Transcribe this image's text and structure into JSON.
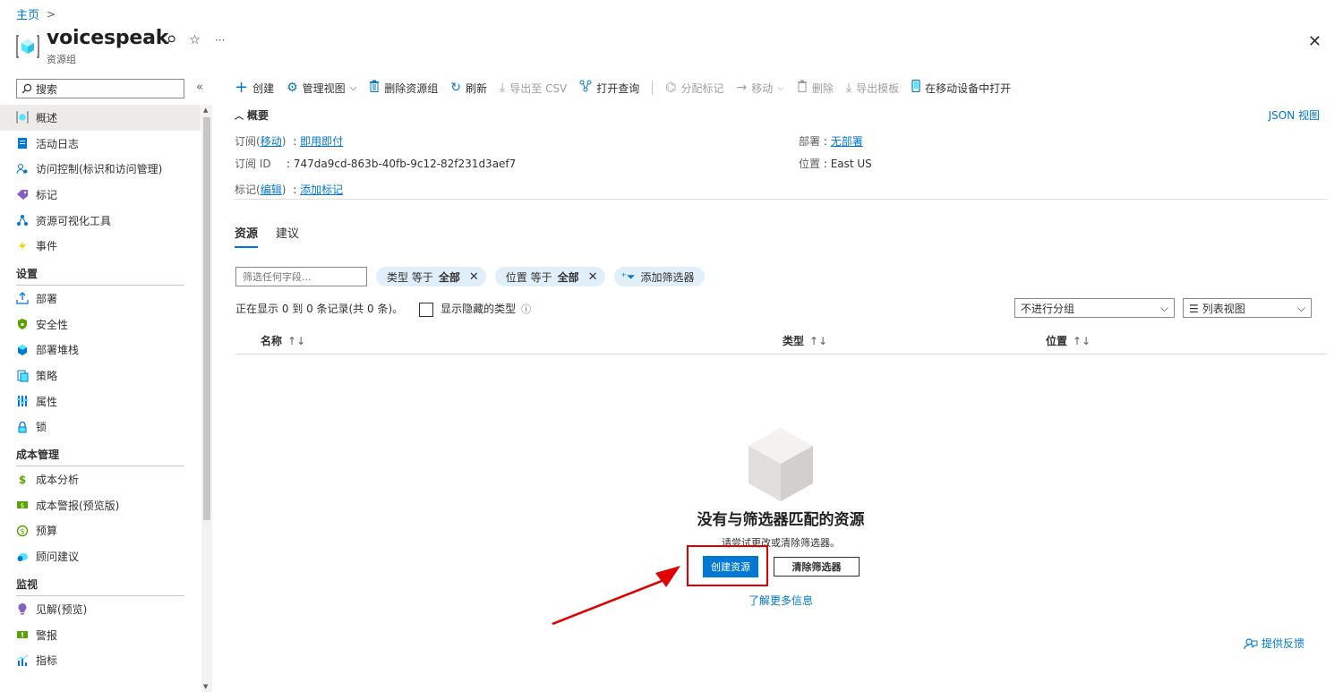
{
  "breadcrumb": {
    "home": "主页",
    "sep": ">"
  },
  "header": {
    "title": "voicespeak",
    "subtitle": "资源组",
    "pin": "⚲",
    "star": "☆",
    "more": "···",
    "close": "✕"
  },
  "sidebar": {
    "search_placeholder": "搜索",
    "collapse": "«",
    "items": [
      {
        "label": "概述",
        "icon": "resource-group-icon"
      },
      {
        "label": "活动日志",
        "icon": "activity-log-icon"
      },
      {
        "label": "访问控制(标识和访问管理)",
        "icon": "people-icon"
      },
      {
        "label": "标记",
        "icon": "tag-icon"
      },
      {
        "label": "资源可视化工具",
        "icon": "visualizer-icon"
      },
      {
        "label": "事件",
        "icon": "lightning-icon"
      }
    ],
    "sections": [
      {
        "title": "设置",
        "items": [
          {
            "label": "部署",
            "icon": "deploy-icon"
          },
          {
            "label": "安全性",
            "icon": "shield-icon"
          },
          {
            "label": "部署堆栈",
            "icon": "stack-icon"
          },
          {
            "label": "策略",
            "icon": "policy-icon"
          },
          {
            "label": "属性",
            "icon": "properties-icon"
          },
          {
            "label": "锁",
            "icon": "lock-icon"
          }
        ]
      },
      {
        "title": "成本管理",
        "items": [
          {
            "label": "成本分析",
            "icon": "cost-analysis-icon"
          },
          {
            "label": "成本警报(预览版)",
            "icon": "cost-alert-icon"
          },
          {
            "label": "预算",
            "icon": "budget-icon"
          },
          {
            "label": "顾问建议",
            "icon": "advisor-icon"
          }
        ]
      },
      {
        "title": "监视",
        "items": [
          {
            "label": "见解(预览)",
            "icon": "insights-icon"
          },
          {
            "label": "警报",
            "icon": "alert-icon"
          },
          {
            "label": "指标",
            "icon": "metrics-icon"
          }
        ]
      }
    ]
  },
  "toolbar": {
    "create": "创建",
    "manage_view": "管理视图",
    "delete_rg": "删除资源组",
    "refresh": "刷新",
    "export_csv": "导出至 CSV",
    "open_query": "打开查询",
    "assign_tags": "分配标记",
    "move": "移动",
    "delete": "删除",
    "export_template": "导出模板",
    "open_mobile": "在移动设备中打开"
  },
  "overview": {
    "heading": "概要",
    "json_view": "JSON 视图",
    "subscription_label": "订阅",
    "subscription_move": "移动",
    "subscription_value": "即用即付",
    "subscription_id_label": "订阅 ID",
    "subscription_id_value": "747da9cd-863b-40fb-9c12-82f231d3aef7",
    "tags_label": "标记",
    "tags_edit": "编辑",
    "tags_value": "添加标记",
    "deployments_label": "部署",
    "deployments_value": "无部署",
    "location_label": "位置",
    "location_value": "East US"
  },
  "tabs": {
    "resources": "资源",
    "recommendations": "建议"
  },
  "filters": {
    "placeholder": "筛选任何字段...",
    "type_label": "类型 等于",
    "type_value": "全部",
    "location_label": "位置 等于",
    "location_value": "全部",
    "add_filter": "添加筛选器"
  },
  "status": {
    "count_text": "正在显示 0 到 0 条记录(共 0 条)。",
    "show_hidden": "显示隐藏的类型",
    "group_by": "不进行分组",
    "view_mode": "列表视图"
  },
  "grid": {
    "columns": [
      {
        "label": "名称",
        "sort": "↑↓"
      },
      {
        "label": "类型",
        "sort": "↑↓"
      },
      {
        "label": "位置",
        "sort": "↑↓"
      }
    ]
  },
  "empty": {
    "title": "没有与筛选器匹配的资源",
    "subtitle": "请尝试更改或清除筛选器。",
    "create_btn": "创建资源",
    "clear_btn": "清除筛选器",
    "learn_more": "了解更多信息"
  },
  "feedback": "提供反馈",
  "colors": {
    "accent": "#0078d4",
    "highlight": "#e00000"
  }
}
